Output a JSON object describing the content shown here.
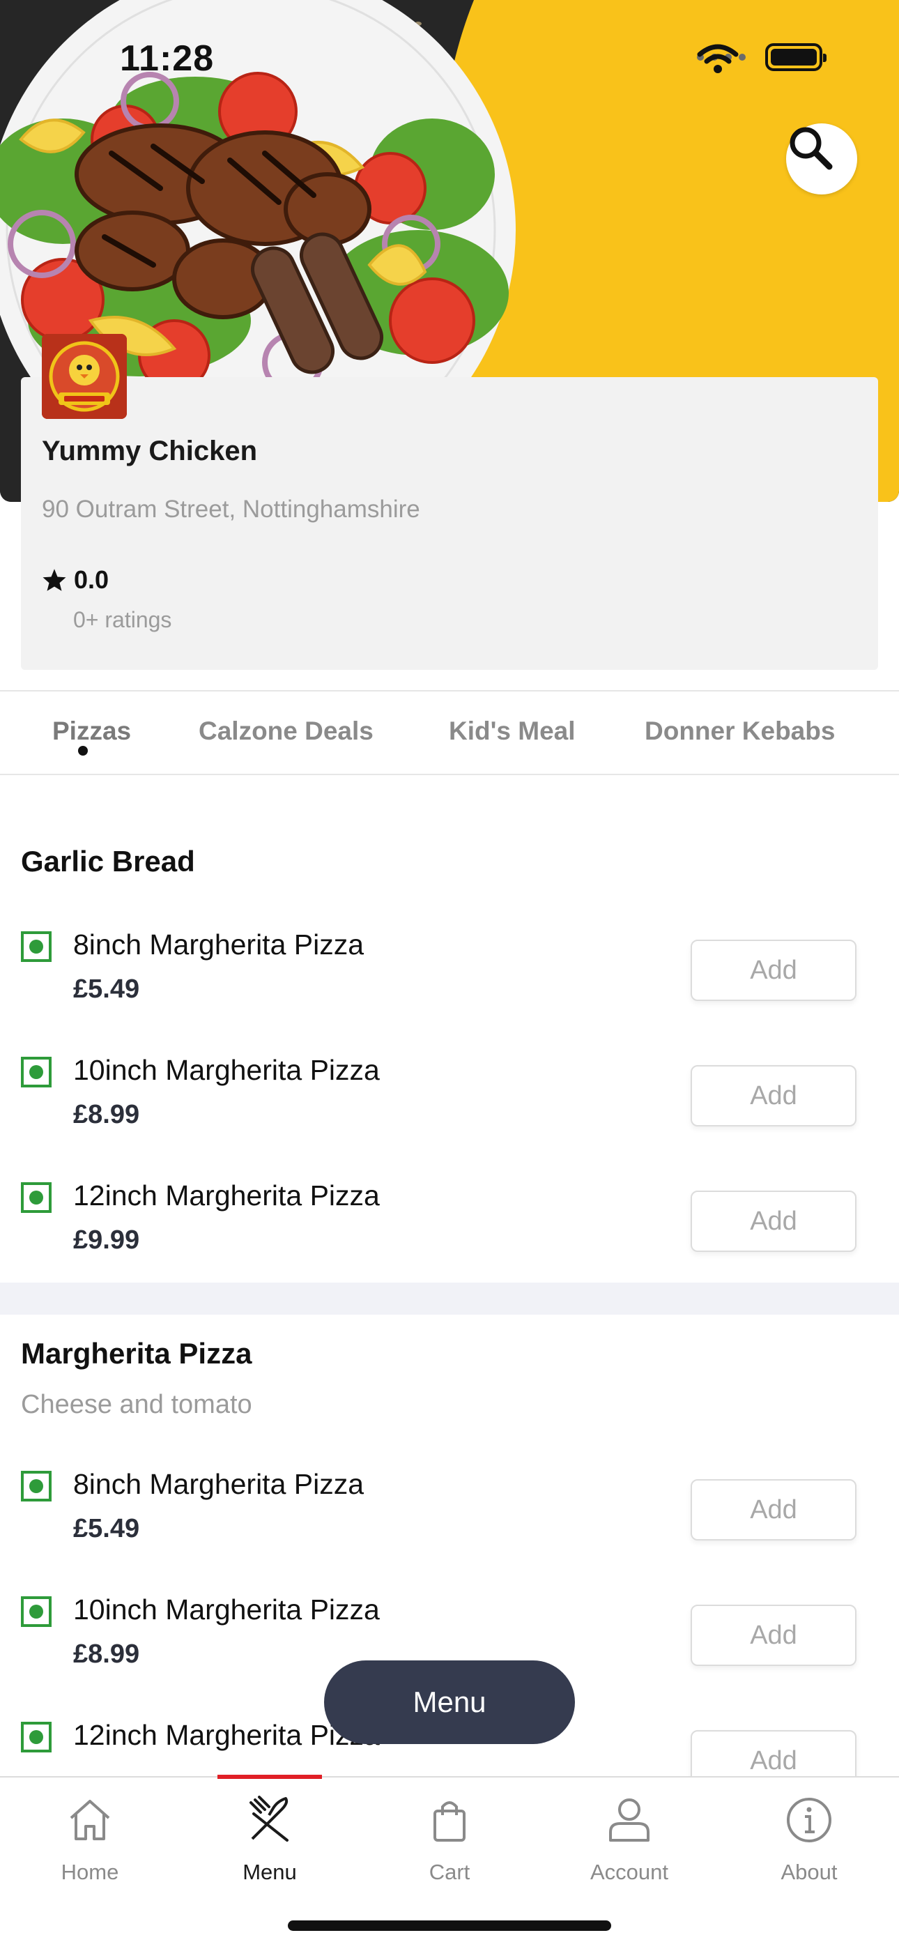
{
  "status_bar": {
    "time": "11:28"
  },
  "restaurant": {
    "name": "Yummy Chicken",
    "address": "90 Outram Street, Nottinghamshire",
    "rating": "0.0",
    "rating_count": "0+ ratings",
    "logo_text": "YUMMY CHICKEN"
  },
  "tabs": [
    {
      "label": "Pizzas"
    },
    {
      "label": "Calzone Deals"
    },
    {
      "label": "Kid's Meal"
    },
    {
      "label": "Donner Kebabs"
    }
  ],
  "sections": [
    {
      "title": "Garlic Bread",
      "items": [
        {
          "name": "8inch Margherita Pizza",
          "price": "£5.49",
          "add_label": "Add"
        },
        {
          "name": "10inch Margherita Pizza",
          "price": "£8.99",
          "add_label": "Add"
        },
        {
          "name": "12inch Margherita Pizza",
          "price": "£9.99",
          "add_label": "Add"
        }
      ]
    },
    {
      "title": "Margherita Pizza",
      "subtitle": "Cheese and tomato",
      "items": [
        {
          "name": "8inch Margherita Pizza",
          "price": "£5.49",
          "add_label": "Add"
        },
        {
          "name": "10inch Margherita Pizza",
          "price": "£8.99",
          "add_label": "Add"
        },
        {
          "name": "12inch Margherita Pizza",
          "add_label": "Add"
        }
      ]
    }
  ],
  "floating_button": {
    "label": "Menu"
  },
  "bottom_nav": [
    {
      "label": "Home",
      "icon": "home-icon"
    },
    {
      "label": "Menu",
      "icon": "fork-knife-icon",
      "active": true
    },
    {
      "label": "Cart",
      "icon": "shopping-bag-icon"
    },
    {
      "label": "Account",
      "icon": "user-icon"
    },
    {
      "label": "About",
      "icon": "info-icon"
    }
  ],
  "colors": {
    "hero_yellow": "#f9c21a",
    "veg_green": "#2e9b3a",
    "float_button": "#353b4f",
    "active_indicator": "#e01f26"
  }
}
